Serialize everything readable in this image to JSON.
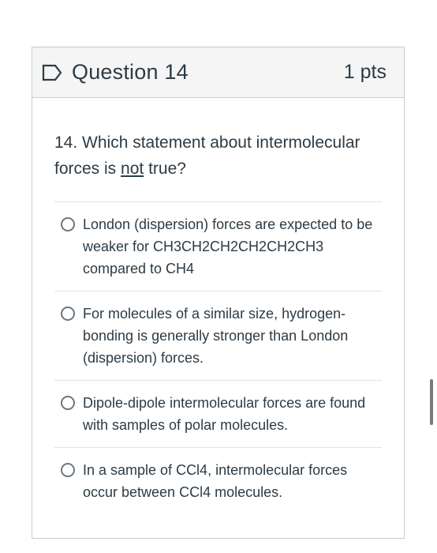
{
  "question": {
    "title": "Question 14",
    "points": "1 pts",
    "prefix": "14. Which statement about intermolecular forces is ",
    "emphasis": "not",
    "suffix": " true?"
  },
  "answers": [
    {
      "label": "London (dispersion) forces are expected to be weaker for CH3CH2CH2CH2CH2CH3 compared to CH4"
    },
    {
      "label": "For molecules of a similar size, hydrogen-bonding is generally stronger than London (dispersion) forces."
    },
    {
      "label": "Dipole-dipole intermolecular forces are found with samples of polar molecules."
    },
    {
      "label": "In a sample of CCl4, intermolecular forces occur between CCl4 molecules."
    }
  ],
  "icons": {
    "flag": "flag-outline-icon"
  },
  "colors": {
    "text": "#2d3b45",
    "header_bg": "#f5f5f5",
    "border": "#c7cdd1",
    "flag": "#2d3b45"
  }
}
